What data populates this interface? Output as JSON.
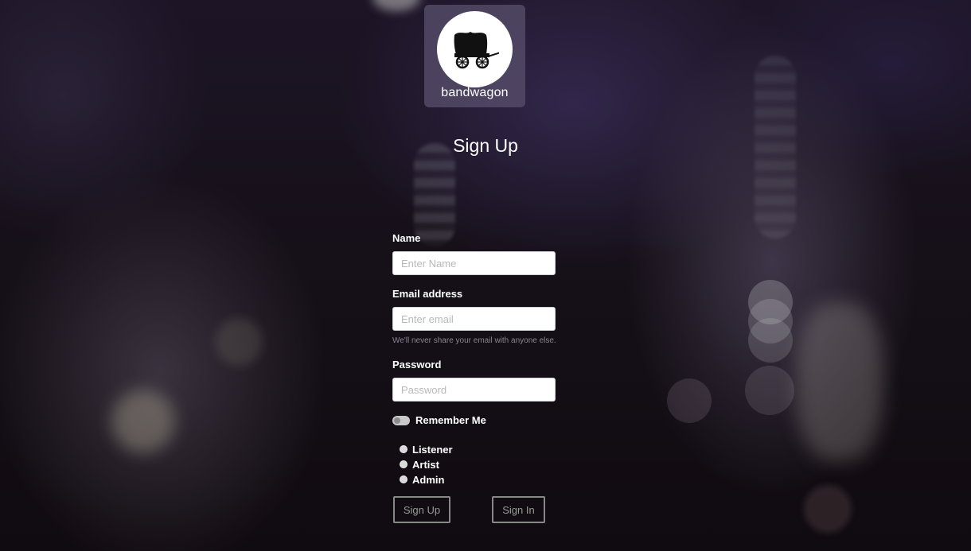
{
  "brand": {
    "name": "bandwagon"
  },
  "page": {
    "title": "Sign Up"
  },
  "form": {
    "name": {
      "label": "Name",
      "placeholder": "Enter Name",
      "value": ""
    },
    "email": {
      "label": "Email address",
      "placeholder": "Enter email",
      "value": "",
      "help": "We'll never share your email with anyone else."
    },
    "password": {
      "label": "Password",
      "placeholder": "Password",
      "value": ""
    },
    "remember": {
      "label": "Remember Me",
      "checked": false
    },
    "roles": [
      {
        "label": "Listener",
        "selected": false
      },
      {
        "label": "Artist",
        "selected": false
      },
      {
        "label": "Admin",
        "selected": false
      }
    ]
  },
  "buttons": {
    "sign_up": "Sign Up",
    "sign_in": "Sign In"
  },
  "colors": {
    "button_border": "#888888",
    "logo_bg": "#5a506e"
  }
}
